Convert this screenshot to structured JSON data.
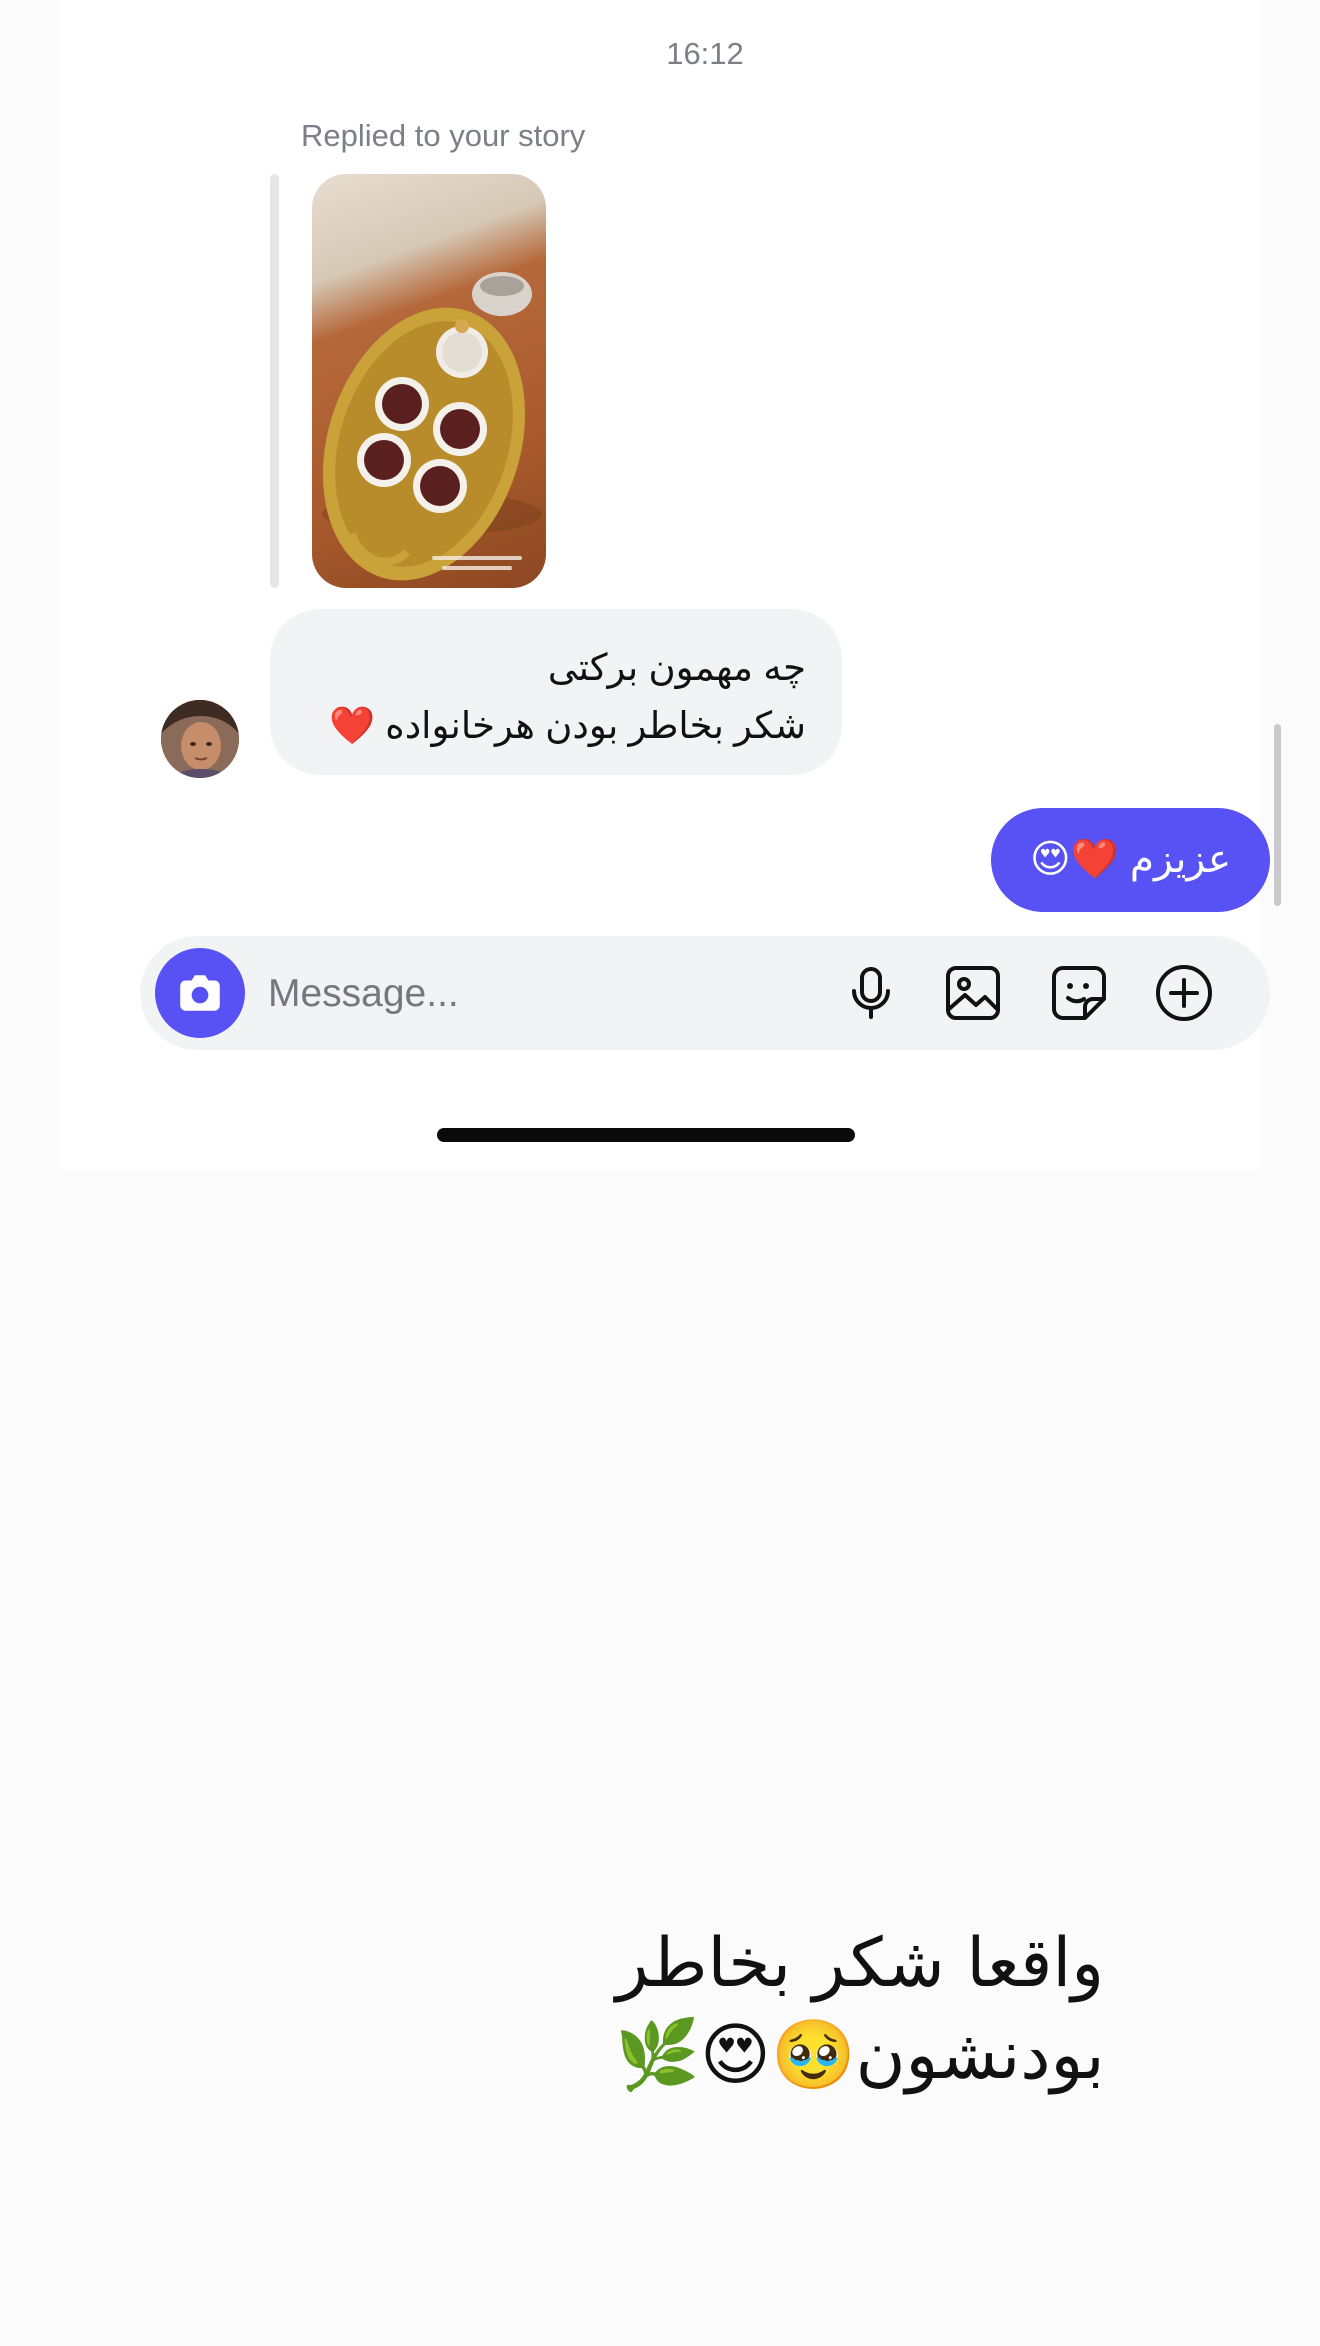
{
  "chat": {
    "timestamp": "16:12",
    "reply_label": "Replied to your story",
    "story_image_alt": "story-image-tea-tray",
    "incoming_message": {
      "line1": "چه مهمون برکتی",
      "line2": "شکر بخاطر بودن هرخانواده ❤️"
    },
    "outgoing_message": "عزیزم ❤️😍"
  },
  "composer": {
    "placeholder": "Message...",
    "icons": [
      "camera-icon",
      "microphone-icon",
      "gallery-icon",
      "sticker-icon",
      "plus-icon"
    ]
  },
  "caption": {
    "line1": "واقعا شکر بخاطر",
    "line2": "بودنشون🥹😍🌿"
  },
  "colors": {
    "accent": "#5851f3",
    "incoming_bubble": "#f2f3f5",
    "muted_text": "#7c7f87"
  }
}
